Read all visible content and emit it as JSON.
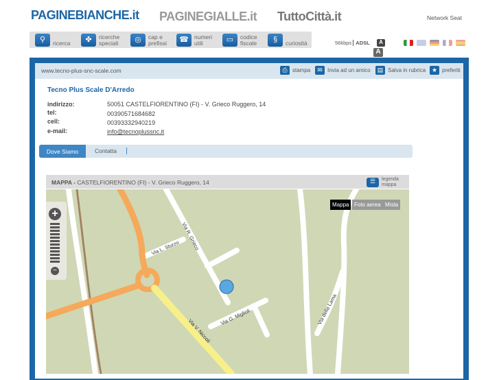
{
  "header": {
    "logos": [
      "PAGINEBIANCHE.it",
      "PAGINEGIALLE.it",
      "TuttoCittà.it"
    ],
    "network": "Network Seat"
  },
  "nav": [
    {
      "label": "ricerca",
      "icon": "search-icon"
    },
    {
      "label": "ricerche speciali",
      "icon": "clover-icon"
    },
    {
      "label": "cap e prefissi",
      "icon": "globe-search-icon"
    },
    {
      "label": "numeri utili",
      "icon": "phone-icon"
    },
    {
      "label": "codice fiscale",
      "icon": "card-icon"
    },
    {
      "label": "curiosità",
      "icon": "spiral-icon"
    }
  ],
  "connection": {
    "speed": "56kbps",
    "type": "ADSL",
    "font_a": "A"
  },
  "url": "www.tecno-plus-snc-scale.com",
  "actions": [
    "stampa",
    "Invia ad un amico",
    "Salva in rubrica",
    "preferiti"
  ],
  "company": {
    "name": "Tecno Plus Scale D'Arredo",
    "fields": [
      {
        "label": "indirizzo:",
        "value": "50051 CASTELFIORENTINO (FI) - V. Grieco Ruggero, 14"
      },
      {
        "label": "tel:",
        "value": "00390571684682"
      },
      {
        "label": "cell:",
        "value": "00393332940219"
      },
      {
        "label": "e-mail:",
        "value": "info@tecnoplussnc.it"
      }
    ]
  },
  "tabs": [
    "Dove Siamo",
    "Contatta"
  ],
  "map": {
    "title": "MAPPA -",
    "address": "CASTELFIORENTINO (FI) - V. Grieco Ruggero, 14",
    "legend": "legenda mappa",
    "types": [
      "Mappa",
      "Foto aerea",
      "Mista"
    ],
    "marker": "1",
    "streets": [
      "Via L. Sturzo",
      "Via R. Grieco",
      "Via G. Miglioli",
      "Via V. Niccoli",
      "Via della Lama"
    ]
  },
  "colors": {
    "brand": "#1b66a6",
    "map_bg": "#d0d7b5",
    "road_main": "#f5a95a",
    "road_yellow": "#f7f08a"
  }
}
